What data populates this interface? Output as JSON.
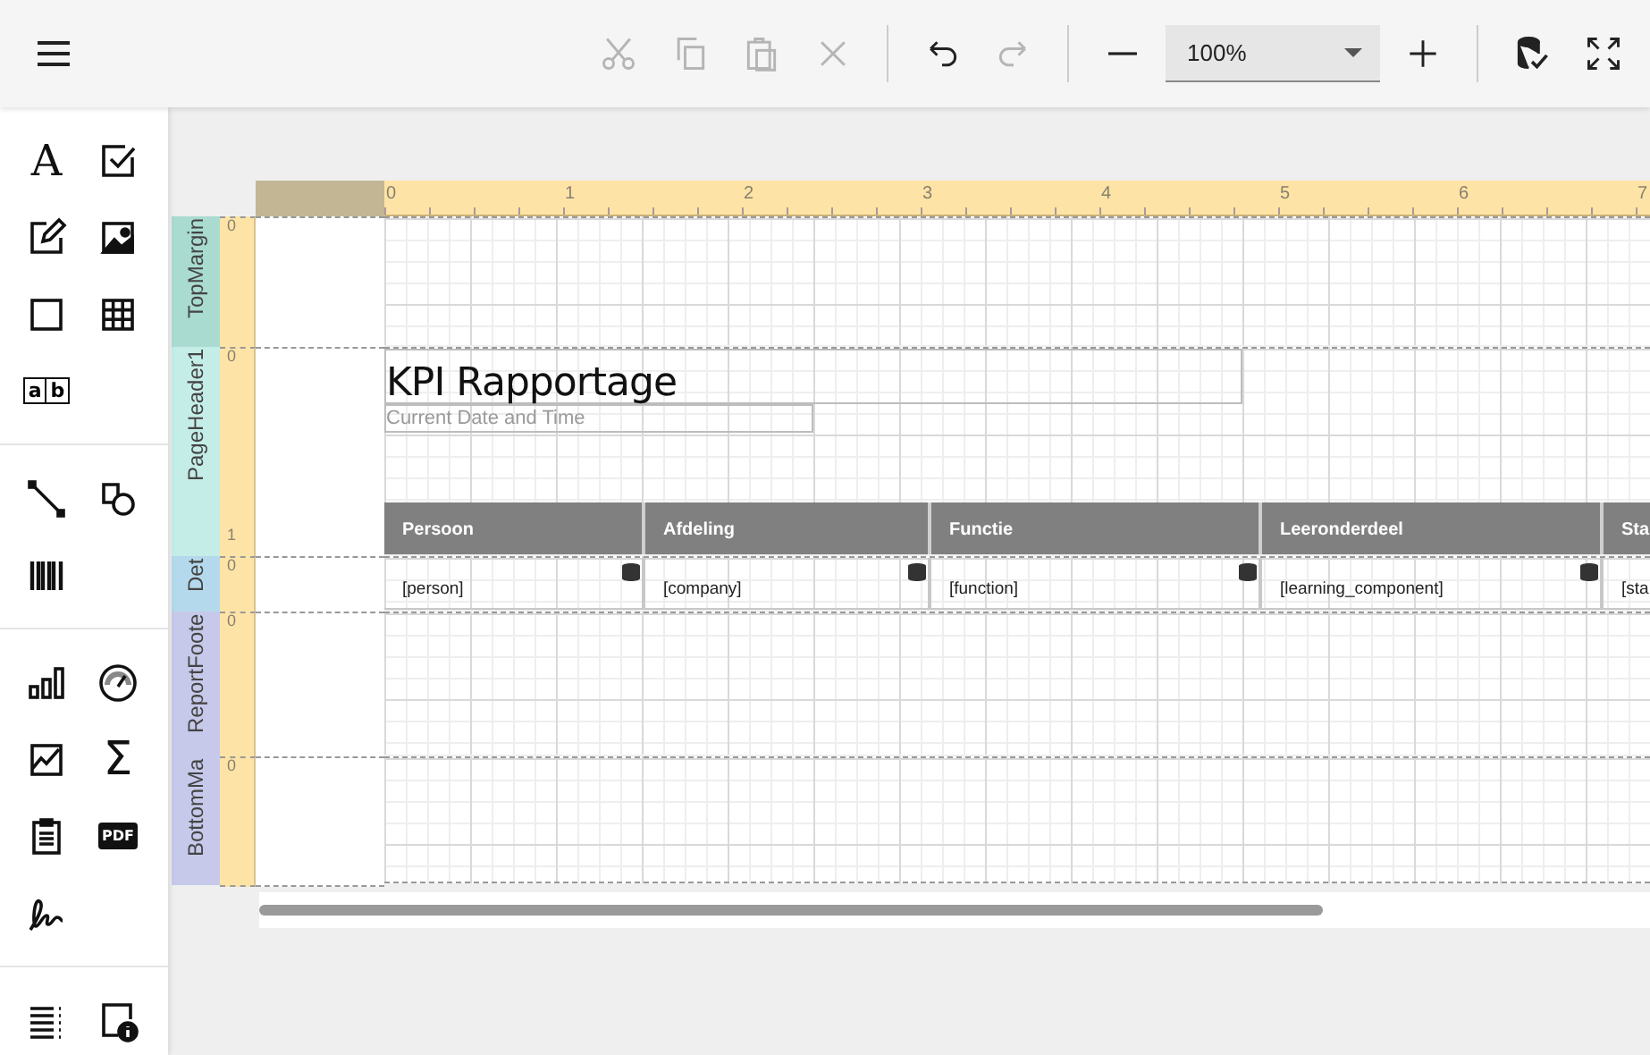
{
  "toolbar": {
    "actions": [
      {
        "kind": "cut",
        "disabled": true
      },
      {
        "kind": "copy",
        "disabled": true
      },
      {
        "kind": "paste",
        "disabled": true
      },
      {
        "kind": "delete",
        "disabled": true
      },
      {
        "kind": "separator"
      },
      {
        "kind": "undo",
        "disabled": false
      },
      {
        "kind": "redo",
        "disabled": true
      },
      {
        "kind": "separator"
      },
      {
        "kind": "zoom-out",
        "disabled": false
      },
      {
        "kind": "zoom",
        "value": "100%"
      },
      {
        "kind": "zoom-in",
        "disabled": false
      },
      {
        "kind": "separator"
      },
      {
        "kind": "validate",
        "disabled": false
      },
      {
        "kind": "fullscreen",
        "disabled": false
      }
    ]
  },
  "toolbox": {
    "groups": [
      [
        {
          "kind": "label",
          "glyph": "A"
        },
        {
          "kind": "checkbox"
        },
        {
          "kind": "richtext"
        },
        {
          "kind": "picture"
        },
        {
          "kind": "panel"
        },
        {
          "kind": "table"
        },
        {
          "kind": "comb",
          "glyphs": [
            "a",
            "b"
          ]
        }
      ],
      [
        {
          "kind": "line"
        },
        {
          "kind": "shape"
        },
        {
          "kind": "barcode"
        }
      ],
      [
        {
          "kind": "chart"
        },
        {
          "kind": "gauge"
        },
        {
          "kind": "sparkline"
        },
        {
          "kind": "summary",
          "glyph": "Σ"
        },
        {
          "kind": "subreport"
        },
        {
          "kind": "pdf",
          "glyph": "PDF"
        },
        {
          "kind": "signature"
        }
      ],
      [
        {
          "kind": "contents"
        },
        {
          "kind": "pageinfo"
        }
      ]
    ]
  },
  "ruler": {
    "labels": [
      "0",
      "1",
      "2",
      "3",
      "4",
      "5",
      "6",
      "7"
    ]
  },
  "bands": [
    {
      "name": "TopMargin",
      "kind": "margin",
      "color": "#a9dbd0",
      "ruler_marks": [
        "0"
      ]
    },
    {
      "name": "PageHeader1",
      "kind": "page_header",
      "color": "#c5ede7",
      "ruler_marks": [
        "0",
        "1"
      ]
    },
    {
      "name": "Det",
      "kind": "detail",
      "color": "#b5d9ec",
      "ruler_marks": [
        "0"
      ]
    },
    {
      "name": "ReportFoote",
      "kind": "footer",
      "color": "#c6c9e9",
      "ruler_marks": [
        "0"
      ]
    },
    {
      "name": "BottomMa",
      "kind": "margin",
      "color": "#c6c9e9",
      "ruler_marks": [
        "0"
      ]
    }
  ],
  "page_header": {
    "title": "KPI Rapportage",
    "subtitle": "Current Date and Time",
    "columns": [
      "Persoon",
      "Afdeling",
      "Functie",
      "Leeronderdeel",
      "Sta"
    ]
  },
  "detail": {
    "cells": [
      "[person]",
      "[company]",
      "[function]",
      "[learning_component]",
      "[sta"
    ]
  }
}
